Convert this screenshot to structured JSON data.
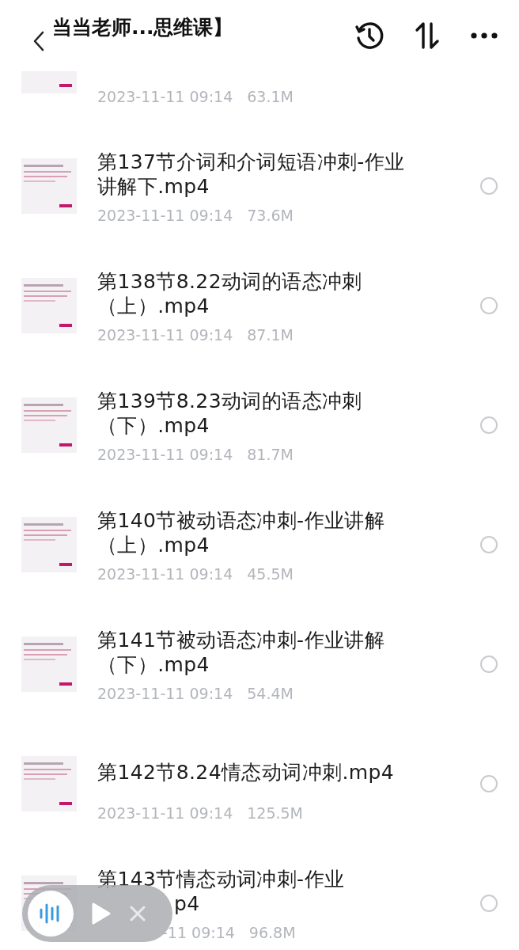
{
  "header": {
    "title": "当当老师...思维课】"
  },
  "rows": [
    {
      "date": "2023-11-11 09:14",
      "size": "63.1M",
      "cut": true
    },
    {
      "lines": [
        "第137节介词和介词短语冲刺-作业",
        "讲解下.mp4"
      ],
      "date": "2023-11-11 09:14",
      "size": "73.6M",
      "selected": false
    },
    {
      "lines": [
        "第138节8.22动词的语态冲刺",
        "（上）.mp4"
      ],
      "date": "2023-11-11 09:14",
      "size": "87.1M",
      "selected": false
    },
    {
      "lines": [
        "第139节8.23动词的语态冲刺",
        "（下）.mp4"
      ],
      "date": "2023-11-11 09:14",
      "size": "81.7M",
      "selected": false
    },
    {
      "lines": [
        "第140节被动语态冲刺-作业讲解",
        "（上）.mp4"
      ],
      "date": "2023-11-11 09:14",
      "size": "45.5M",
      "selected": false
    },
    {
      "lines": [
        "第141节被动语态冲刺-作业讲解",
        "（下）.mp4"
      ],
      "date": "2023-11-11 09:14",
      "size": "54.4M",
      "selected": false
    },
    {
      "lines": [
        "第142节8.24情态动词冲刺.mp4"
      ],
      "date": "2023-11-11 09:14",
      "size": "125.5M",
      "selected": false
    },
    {
      "lines": [
        "第143节情态动词冲刺-作业",
        "p4"
      ],
      "date": "-11 09:14",
      "size": "96.8M",
      "selected": false,
      "covered": true
    }
  ],
  "player": {
    "visible": true
  }
}
